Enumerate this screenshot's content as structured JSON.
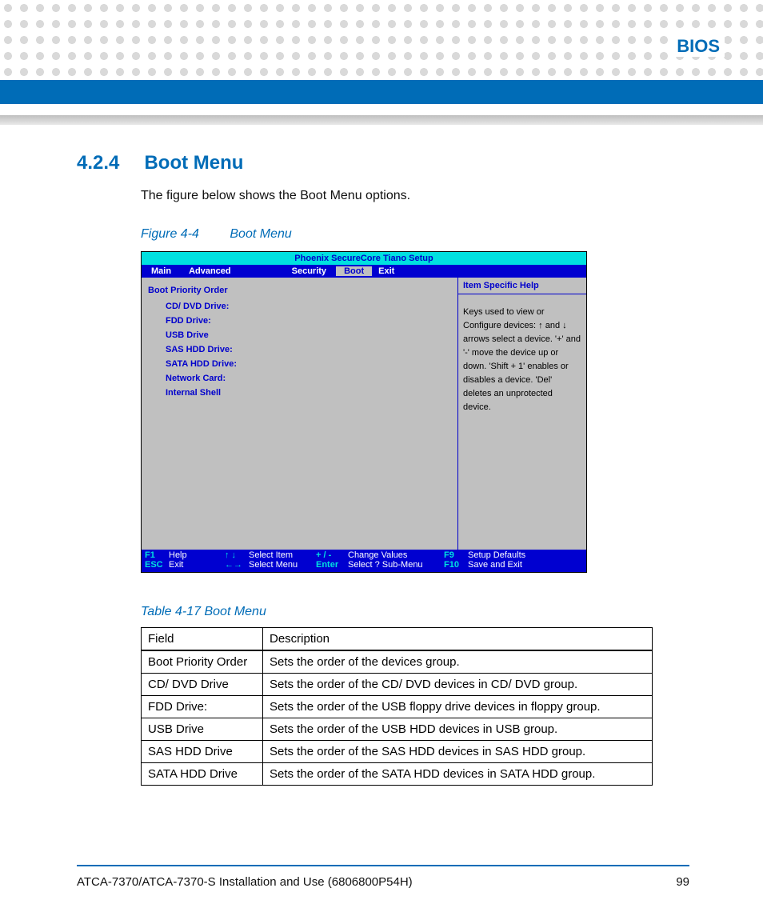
{
  "header": {
    "title": "BIOS"
  },
  "section": {
    "number": "4.2.4",
    "title": "Boot Menu",
    "intro": "The figure below shows the Boot Menu options."
  },
  "figure": {
    "label": "Figure 4-4",
    "title": "Boot Menu",
    "bios": {
      "title": "Phoenix SecureCore Tiano Setup",
      "tabs": {
        "main": "Main",
        "advanced": "Advanced",
        "security": "Security",
        "boot": "Boot",
        "exit": "Exit"
      },
      "bpo_header": "Boot Priority Order",
      "items": [
        "CD/ DVD Drive:",
        "FDD Drive:",
        "USB Drive",
        "SAS HDD Drive:",
        "SATA HDD Drive:",
        "Network Card:",
        "Internal Shell"
      ],
      "help_header": "Item Specific Help",
      "help_body": "Keys used to view or Configure devices: ↑ and ↓ arrows select a device. '+' and '-' move the device up or down. 'Shift + 1' enables or disables a device. 'Del' deletes an unprotected device.",
      "footer": {
        "f1": "F1",
        "help": "Help",
        "updn": "↑ ↓",
        "sel_item": "Select Item",
        "pm": "+ / -",
        "chg": "Change Values",
        "f9": "F9",
        "defaults": "Setup Defaults",
        "esc": "ESC",
        "exit": "Exit",
        "lr": "←→",
        "sel_menu": "Select Menu",
        "enter": "Enter",
        "sub": "Select ? Sub-Menu",
        "f10": "F10",
        "save": "Save and Exit"
      }
    }
  },
  "table": {
    "caption": "Table 4-17 Boot Menu",
    "headers": {
      "field": "Field",
      "desc": "Description"
    },
    "rows": [
      {
        "field": "Boot Priority Order",
        "desc": "Sets the order of the devices group."
      },
      {
        "field": "CD/ DVD Drive",
        "desc": "Sets the order of the CD/ DVD devices in CD/ DVD group."
      },
      {
        "field": "FDD Drive:",
        "desc": "Sets the order of the USB floppy drive devices in floppy group."
      },
      {
        "field": "USB Drive",
        "desc": "Sets the order of the USB HDD devices in USB group."
      },
      {
        "field": "SAS HDD Drive",
        "desc": "Sets the order of the SAS HDD devices in SAS HDD group."
      },
      {
        "field": "SATA HDD Drive",
        "desc": "Sets the order of the SATA HDD devices in SATA HDD group."
      }
    ]
  },
  "footer": {
    "text": "ATCA-7370/ATCA-7370-S Installation and Use (6806800P54H)",
    "page": "99"
  }
}
